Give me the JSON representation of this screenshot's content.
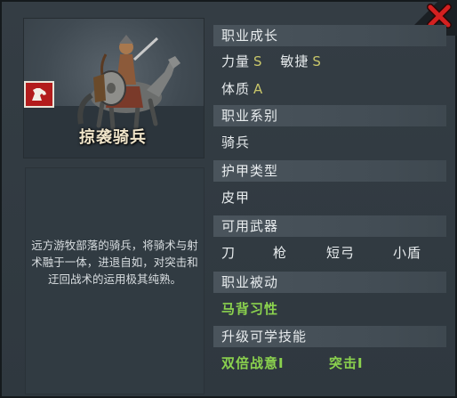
{
  "portrait": {
    "unit_name": "掠袭骑兵",
    "badge_icon": "horse-head-icon",
    "description": "远方游牧部落的骑兵，将骑术与射术融于一体，进退自如，对突击和迂回战术的运用极其纯熟。"
  },
  "sections": {
    "growth": {
      "title": "职业成长",
      "strength_label": "力量",
      "strength_grade": "S",
      "agility_label": "敏捷",
      "agility_grade": "S",
      "constitution_label": "体质",
      "constitution_grade": "A"
    },
    "class_type": {
      "title": "职业系别",
      "value": "骑兵"
    },
    "armor_type": {
      "title": "护甲类型",
      "value": "皮甲"
    },
    "weapons": {
      "title": "可用武器",
      "items": [
        "刀",
        "枪",
        "短弓",
        "小盾"
      ]
    },
    "passive": {
      "title": "职业被动",
      "value": "马背习性"
    },
    "skills": {
      "title": "升级可学技能",
      "items": [
        "双倍战意Ⅰ",
        "突击Ⅰ"
      ]
    }
  },
  "colors": {
    "grade": "#c8c66a",
    "highlight_green": "#8bd24e",
    "close_red": "#d42020",
    "badge_red": "#b31c1c"
  }
}
